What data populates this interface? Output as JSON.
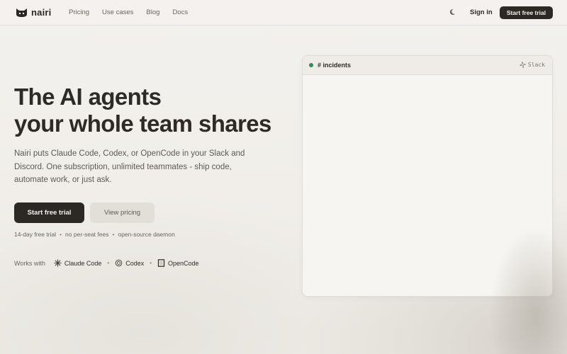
{
  "nav": {
    "brand": "nairi",
    "links": [
      "Pricing",
      "Use cases",
      "Blog",
      "Docs"
    ],
    "sign_in": "Sign in",
    "cta": "Start free trial"
  },
  "hero": {
    "title_line1": "The AI agents",
    "title_line2": "your whole team shares",
    "description": "Nairi puts Claude Code, Codex, or OpenCode in your Slack and Discord. One subscription, unlimited teammates - ship code, automate work, or just ask.",
    "primary_button": "Start free trial",
    "secondary_button": "View pricing",
    "features": [
      "14-day free trial",
      "no per-seat fees",
      "open-source daemon"
    ],
    "works_with_label": "Works with",
    "integrations": [
      {
        "name": "Claude Code",
        "icon": "claude-icon"
      },
      {
        "name": "Codex",
        "icon": "codex-icon"
      },
      {
        "name": "OpenCode",
        "icon": "opencode-icon"
      }
    ]
  },
  "panel": {
    "channel": "# incidents",
    "platform": "Slack",
    "status_color": "#2f8f5b"
  },
  "colors": {
    "accent_dark": "#2c2925",
    "background": "#f3f1ed"
  }
}
